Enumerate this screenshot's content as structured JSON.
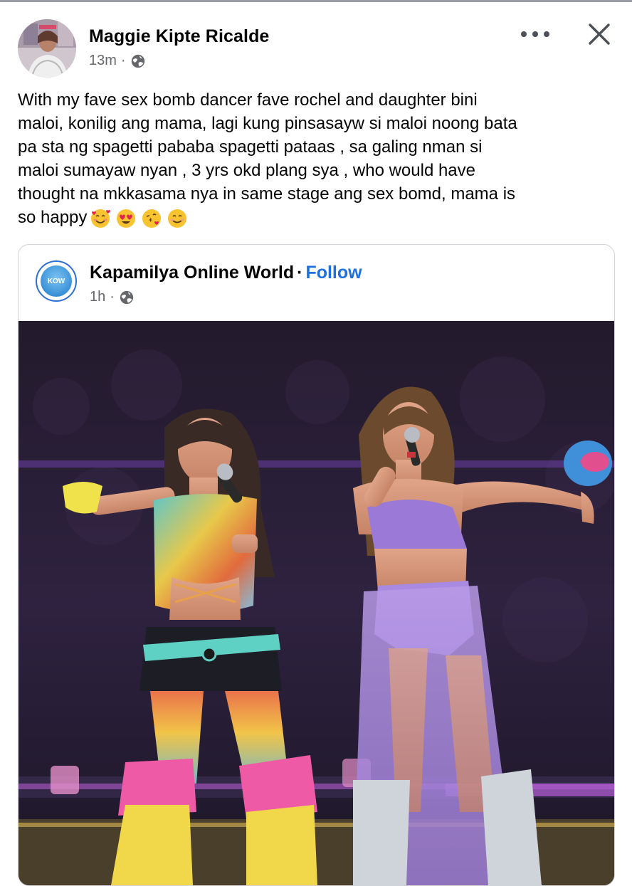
{
  "post": {
    "author": "Maggie Kipte Ricalde",
    "time": "13m",
    "separator": "·",
    "text_lines": [
      "With my fave sex bomb dancer fave rochel and daughter bini",
      "maloi, konilig ang mama, lagi kung pinsasayw si maloi noong bata",
      "pa sta ng spagetti pababa spagetti pataas , sa galing nman si",
      "maloi sumayaw nyan , 3 yrs okd plang sya , who would have",
      "thought na mkkasama nya in same stage ang sex bomd, mama is",
      "so happy"
    ],
    "emojis": [
      "smiling-face-with-hearts",
      "heart-eyes",
      "face-blowing-kiss",
      "smiling-face"
    ]
  },
  "shared": {
    "page_name": "Kapamilya Online World",
    "separator": "·",
    "follow_label": "Follow",
    "time": "1h",
    "avatar_initials": "KOW"
  },
  "icons": {
    "audience": "globe-icon",
    "more": "more-options-icon",
    "close": "close-icon"
  },
  "colors": {
    "follow": "#1f6fe0",
    "meta": "#65676b",
    "text": "#050505",
    "stage_purple": "#8a5fd6"
  }
}
